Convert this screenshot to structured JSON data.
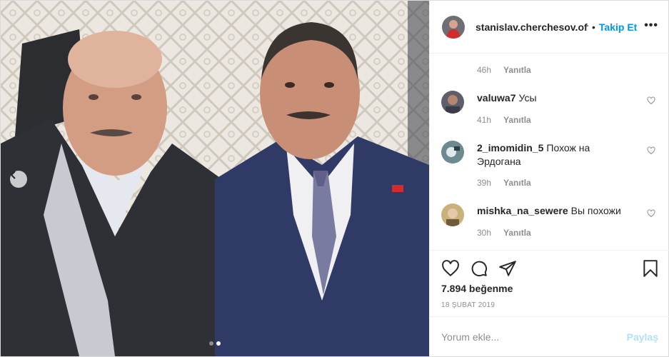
{
  "post": {
    "photo_description_icon": "photo",
    "carousel": {
      "total": 2,
      "active": 2
    }
  },
  "header": {
    "username": "stanislav.cherchesov.offic",
    "separator": "•",
    "follow_label": "Takip Et",
    "more_icon": "more-horizontal-icon",
    "more_label": "•••"
  },
  "comments": {
    "top_meta": {
      "time": "46h",
      "reply": "Yanıtla"
    },
    "items": [
      {
        "user": "valuwa7",
        "text": "Усы",
        "time": "41h",
        "reply": "Yanıtla"
      },
      {
        "user": "2_imomidin_5",
        "text": "Похож на Эрдогана",
        "time": "39h",
        "reply": "Yanıtla"
      },
      {
        "user": "mishka_na_sewere",
        "text": "Вы похожи",
        "time": "30h",
        "reply": "Yanıtla"
      }
    ]
  },
  "actions": {
    "likes": "7.894 beğenme",
    "date": "18 ŞUBAT 2019"
  },
  "comment_box": {
    "placeholder": "Yorum ekle...",
    "post_label": "Paylaş"
  },
  "colors": {
    "accent": "#0095f6",
    "post_disabled": "#b2dffc",
    "muted": "#8e8e8e",
    "border": "#efefef"
  }
}
